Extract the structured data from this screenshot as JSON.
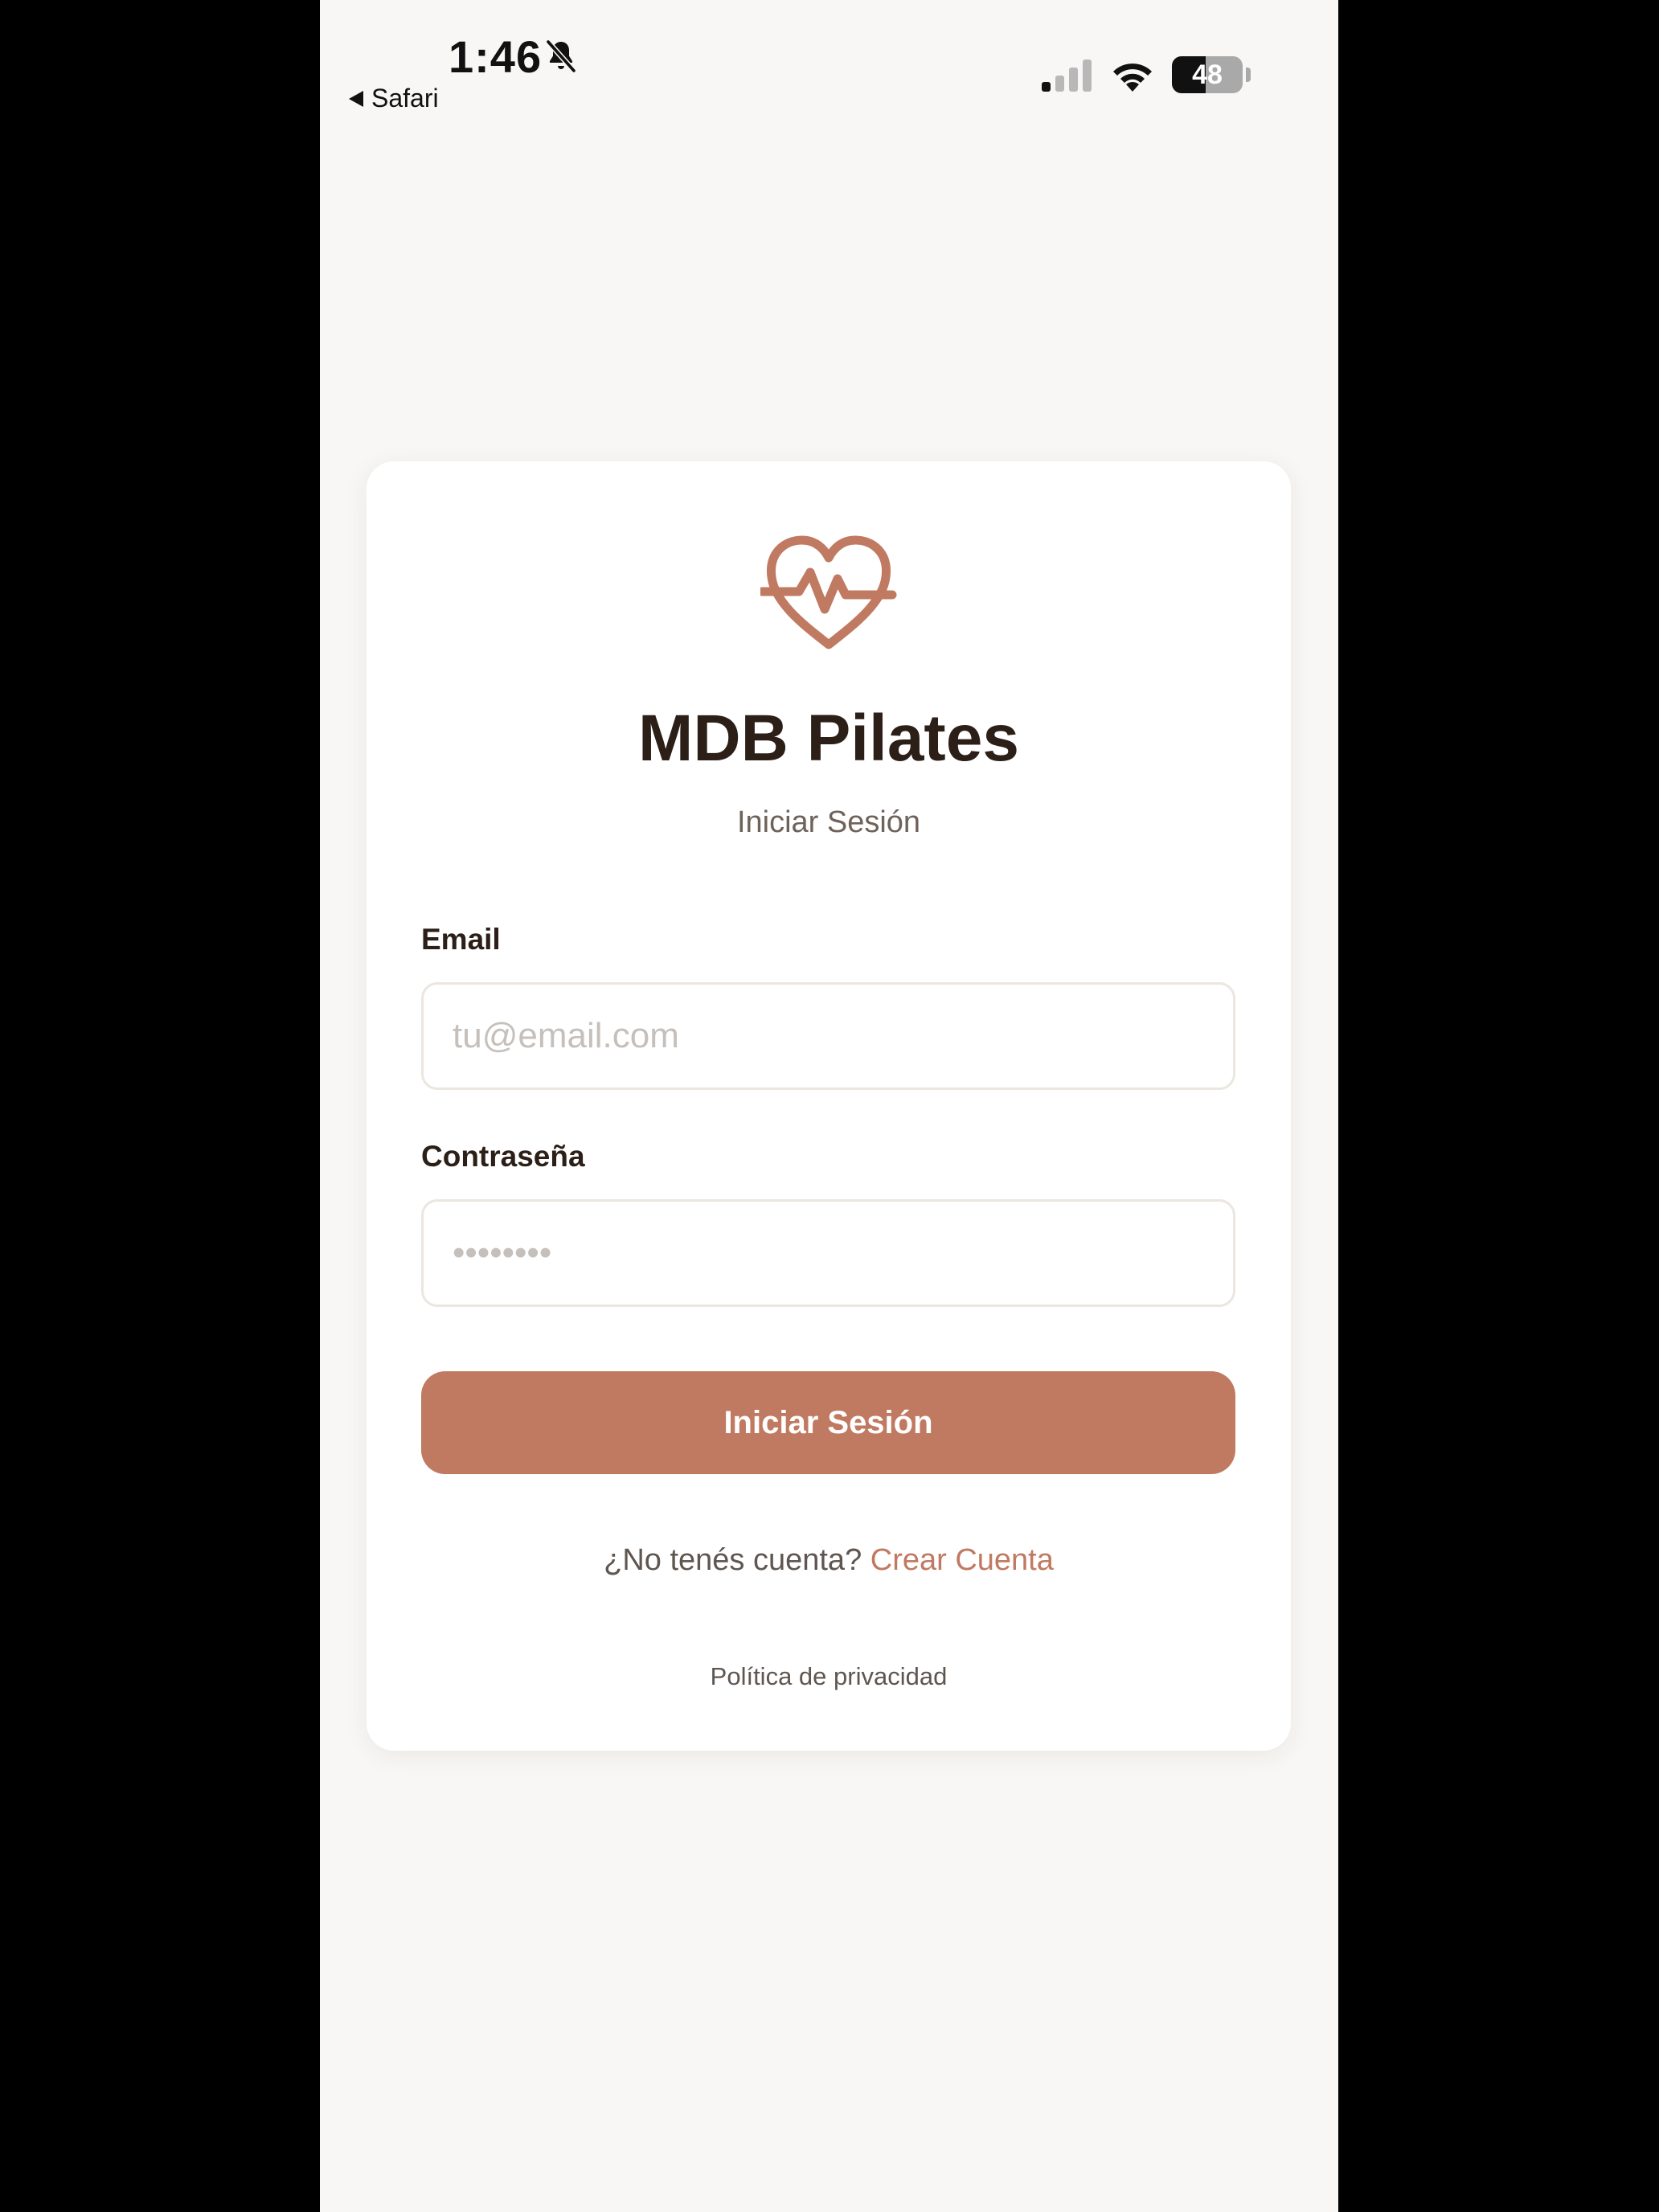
{
  "status_bar": {
    "time": "1:46",
    "back_label": "Safari",
    "battery_percent": "48",
    "battery_level": 0.48,
    "signal_bars_active": 1,
    "icons": [
      "bell-slash-icon",
      "back-arrow-icon",
      "signal-icon",
      "wifi-icon",
      "battery-icon"
    ]
  },
  "login": {
    "logo_icon": "heart-pulse-icon",
    "title": "MDB Pilates",
    "subtitle": "Iniciar Sesión",
    "email_label": "Email",
    "email_placeholder": "tu@email.com",
    "password_label": "Contraseña",
    "password_placeholder": "••••••••",
    "submit_label": "Iniciar Sesión",
    "signup_prompt": "¿No tenés cuenta?",
    "signup_link": "Crear Cuenta",
    "privacy_link": "Política de privacidad"
  },
  "colors": {
    "accent": "#c17a62",
    "title": "#2b1f17",
    "background": "#f8f7f5",
    "card": "#ffffff",
    "input_border": "#ebe6df"
  }
}
